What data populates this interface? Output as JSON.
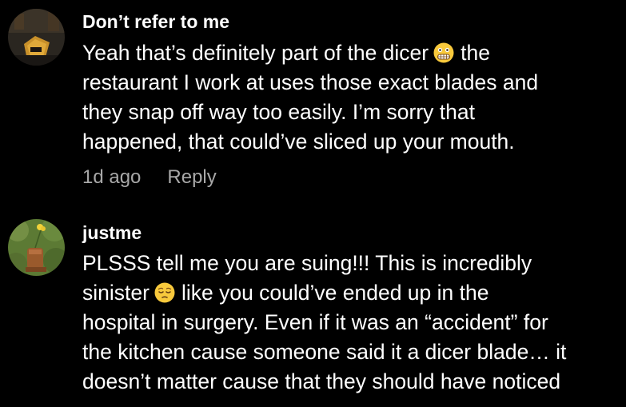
{
  "comments": [
    {
      "username": "Don’t refer to me",
      "lines": [
        {
          "before": "Yeah that’s definitely part of the dicer",
          "emoji": "grimace-emoji",
          "after": "the"
        },
        {
          "text": "restaurant I work at uses those exact blades and"
        },
        {
          "text": "they snap off way too easily. I’m sorry that"
        },
        {
          "text": "happened, that could’ve sliced up your mouth."
        }
      ],
      "timestamp": "1d ago",
      "reply_label": "Reply"
    },
    {
      "username": "justme",
      "lines": [
        {
          "text": "PLSSS tell me you are suing!!! This is incredibly"
        },
        {
          "before": "sinister",
          "emoji": "pensive-emoji",
          "after": "like you could’ve ended up in the"
        },
        {
          "text": "hospital in surgery. Even if it was an “accident” for"
        },
        {
          "text": "the kitchen cause someone said it a dicer blade… it"
        },
        {
          "text": "doesn’t matter cause that they should have noticed"
        }
      ]
    }
  ],
  "colors": {
    "background": "#000000",
    "text": "#ffffff",
    "meta": "#a8a8a8"
  }
}
